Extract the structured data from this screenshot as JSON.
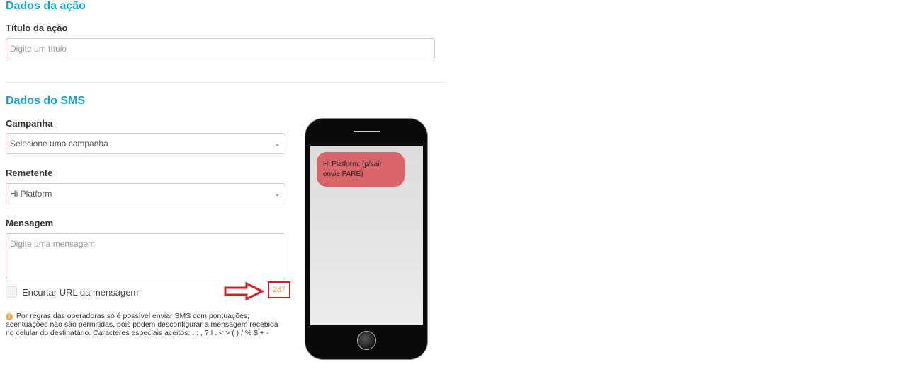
{
  "action_section": {
    "title": "Dados da ação",
    "title_field": {
      "label": "Título da ação",
      "value": "",
      "placeholder": "Digite um título"
    }
  },
  "sms_section": {
    "title": "Dados do SMS",
    "campaign": {
      "label": "Campanha",
      "selected": "Selecione uma campanha"
    },
    "sender": {
      "label": "Remetente",
      "selected": "Hi Platform"
    },
    "message": {
      "label": "Mensagem",
      "value": "",
      "placeholder": "Digite uma mensagem"
    },
    "shorten_url": {
      "label": "Encurtar URL da mensagem",
      "checked": false
    },
    "char_counter": "287",
    "notice": "Por regras das operadoras só é possível enviar SMS com pontuações; acentuações não são permitidas, pois podem desconfigurar a mensagem recebida no celular do destinatário. Caracteres especiais aceitos: ; : , ? ! . < > ( ) / % $ + -"
  },
  "phone_preview": {
    "message": "Hi Platform: (p/sair envie PARE)"
  },
  "colors": {
    "accent": "#1a9fd5",
    "bubble": "#d9646a",
    "highlight": "#d3202a",
    "counter_text": "#e8a060"
  }
}
